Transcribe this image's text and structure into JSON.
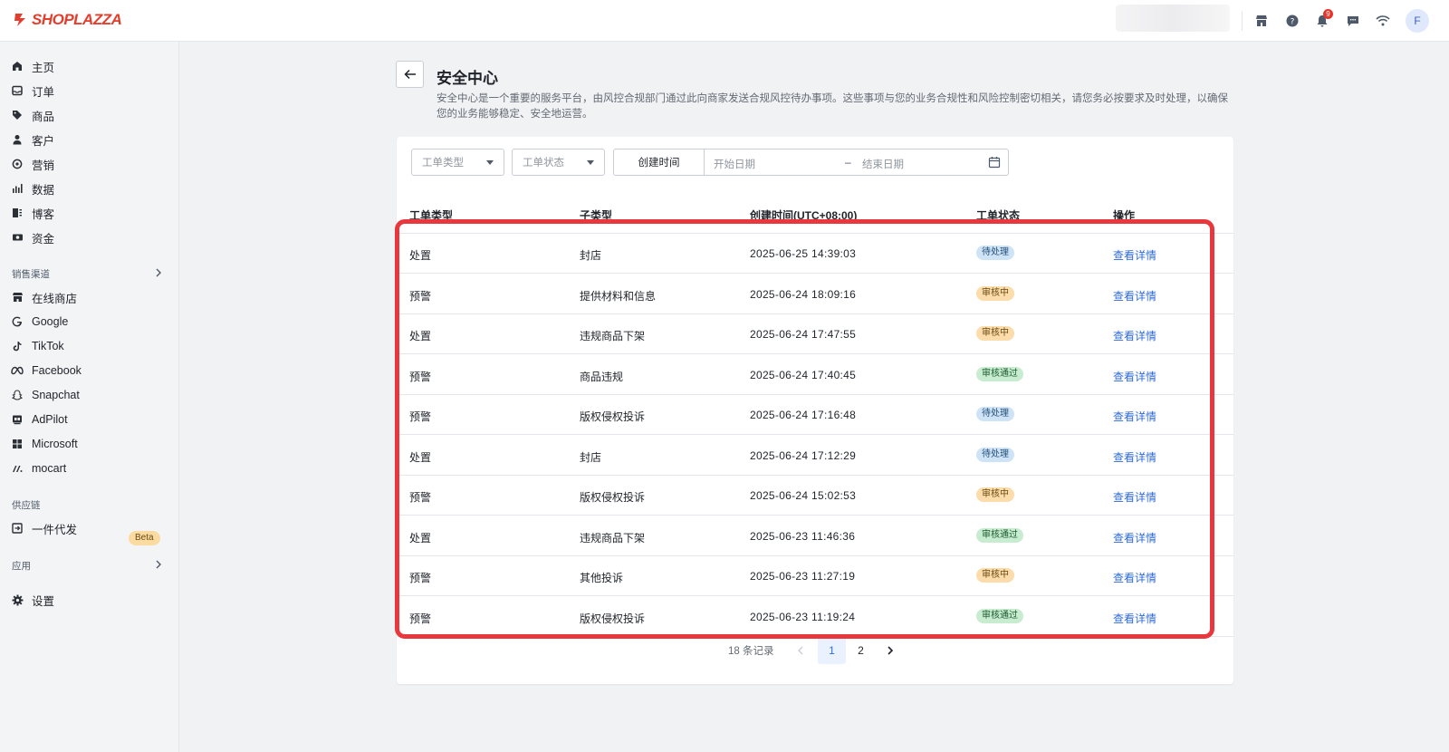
{
  "brand": {
    "logo_text": "SHOPLAZZA",
    "brand_color": "#e23e2e"
  },
  "topbar": {
    "icons": [
      "store-icon",
      "help-icon",
      "bell-icon",
      "message-icon",
      "wifi-icon"
    ],
    "notification_count": "9",
    "avatar_initial": "F"
  },
  "sidebar": {
    "main_items": [
      {
        "label": "主页",
        "icon": "home-icon"
      },
      {
        "label": "订单",
        "icon": "inbox-icon"
      },
      {
        "label": "商品",
        "icon": "tag-icon"
      },
      {
        "label": "客户",
        "icon": "person-icon"
      },
      {
        "label": "营销",
        "icon": "marketing-icon"
      },
      {
        "label": "数据",
        "icon": "bar-chart-icon"
      },
      {
        "label": "博客",
        "icon": "blog-icon"
      },
      {
        "label": "资金",
        "icon": "money-icon"
      }
    ],
    "sales_channels_title": "销售渠道",
    "channels": [
      {
        "label": "在线商店",
        "icon": "store-icon"
      },
      {
        "label": "Google",
        "icon": "google-icon"
      },
      {
        "label": "TikTok",
        "icon": "tiktok-icon"
      },
      {
        "label": "Facebook",
        "icon": "meta-icon"
      },
      {
        "label": "Snapchat",
        "icon": "snapchat-icon"
      },
      {
        "label": "AdPilot",
        "icon": "adpilot-icon"
      },
      {
        "label": "Microsoft",
        "icon": "microsoft-icon"
      },
      {
        "label": "mocart",
        "icon": "mocart-icon"
      }
    ],
    "supply_chain_title": "供应链",
    "supply_item": {
      "label": "一件代发",
      "badge": "Beta",
      "icon": "dropship-icon"
    },
    "apps_title": "应用",
    "settings_label": "设置"
  },
  "page": {
    "title": "安全中心",
    "description": "安全中心是一个重要的服务平台，由风控合规部门通过此向商家发送合规风控待办事项。这些事项与您的业务合规性和风险控制密切相关，请您务必按要求及时处理，以确保您的业务能够稳定、安全地运营。"
  },
  "filters": {
    "type_placeholder": "工单类型",
    "status_placeholder": "工单状态",
    "date_label": "创建时间",
    "start_placeholder": "开始日期",
    "separator": "–",
    "end_placeholder": "结束日期"
  },
  "table": {
    "headers": [
      "工单类型",
      "子类型",
      "创建时间(UTC+08:00)",
      "工单状态",
      "操作"
    ],
    "action_label": "查看详情",
    "rows": [
      {
        "type": "处置",
        "subtype": "封店",
        "time": "2025-06-25 14:39:03",
        "status": "待处理",
        "status_kind": "pending"
      },
      {
        "type": "预警",
        "subtype": "提供材料和信息",
        "time": "2025-06-24 18:09:16",
        "status": "审核中",
        "status_kind": "review"
      },
      {
        "type": "处置",
        "subtype": "违规商品下架",
        "time": "2025-06-24 17:47:55",
        "status": "审核中",
        "status_kind": "review"
      },
      {
        "type": "预警",
        "subtype": "商品违规",
        "time": "2025-06-24 17:40:45",
        "status": "审核通过",
        "status_kind": "passed"
      },
      {
        "type": "预警",
        "subtype": "版权侵权投诉",
        "time": "2025-06-24 17:16:48",
        "status": "待处理",
        "status_kind": "pending"
      },
      {
        "type": "处置",
        "subtype": "封店",
        "time": "2025-06-24 17:12:29",
        "status": "待处理",
        "status_kind": "pending"
      },
      {
        "type": "预警",
        "subtype": "版权侵权投诉",
        "time": "2025-06-24 15:02:53",
        "status": "审核中",
        "status_kind": "review"
      },
      {
        "type": "处置",
        "subtype": "违规商品下架",
        "time": "2025-06-23 11:46:36",
        "status": "审核通过",
        "status_kind": "passed"
      },
      {
        "type": "预警",
        "subtype": "其他投诉",
        "time": "2025-06-23 11:27:19",
        "status": "审核中",
        "status_kind": "review"
      },
      {
        "type": "预警",
        "subtype": "版权侵权投诉",
        "time": "2025-06-23 11:19:24",
        "status": "审核通过",
        "status_kind": "passed"
      }
    ]
  },
  "pagination": {
    "total_text": "18 条记录",
    "pages": [
      "1",
      "2"
    ],
    "current_page": "1"
  },
  "colors": {
    "highlight": "#e8383d",
    "link": "#2f6bd8",
    "pending_bg": "#cfe3f7",
    "review_bg": "#fbdcaa",
    "passed_bg": "#c7ecd0"
  }
}
